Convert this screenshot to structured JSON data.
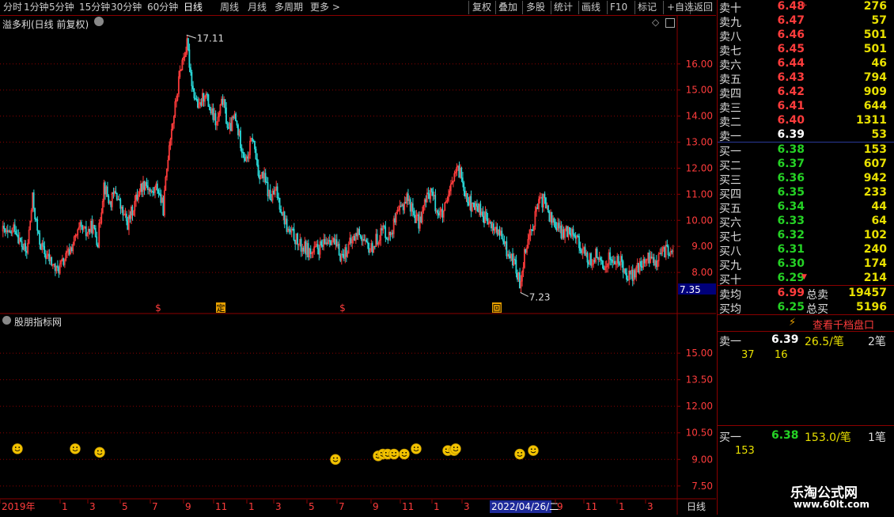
{
  "toolbar": {
    "periods": [
      "分时",
      "1分钟",
      "5分钟",
      "15分钟",
      "30分钟",
      "60分钟",
      "日线",
      "周线",
      "月线",
      "多周期",
      "更多 >"
    ],
    "active_period": "日线",
    "actions": [
      "复权",
      "叠加",
      "多股",
      "统计",
      "画线",
      "F10",
      "标记",
      "+自选",
      "返回"
    ]
  },
  "main_chart": {
    "title": "溢多利(日线 前复权)",
    "high_label": "17.11",
    "low_label": "7.23",
    "current_price": "7.35",
    "markers": [
      {
        "text": "$",
        "x": 200
      },
      {
        "text": "定",
        "x": 279
      },
      {
        "text": "$",
        "x": 433
      },
      {
        "text": "回",
        "x": 628
      }
    ]
  },
  "indicator": {
    "title": "股朋指标网"
  },
  "x_axis": {
    "date_cursor": "2022/04/26/二",
    "period_label": "日线"
  },
  "order_book": {
    "asks": [
      {
        "label": "卖十",
        "price": "6.48",
        "vol": "276",
        "mark": "+"
      },
      {
        "label": "卖九",
        "price": "6.47",
        "vol": "57"
      },
      {
        "label": "卖八",
        "price": "6.46",
        "vol": "501"
      },
      {
        "label": "卖七",
        "price": "6.45",
        "vol": "501"
      },
      {
        "label": "卖六",
        "price": "6.44",
        "vol": "46"
      },
      {
        "label": "卖五",
        "price": "6.43",
        "vol": "794"
      },
      {
        "label": "卖四",
        "price": "6.42",
        "vol": "909"
      },
      {
        "label": "卖三",
        "price": "6.41",
        "vol": "644"
      },
      {
        "label": "卖二",
        "price": "6.40",
        "vol": "1311"
      },
      {
        "label": "卖一",
        "price": "6.39",
        "vol": "53"
      }
    ],
    "bids": [
      {
        "label": "买一",
        "price": "6.38",
        "vol": "153"
      },
      {
        "label": "买二",
        "price": "6.37",
        "vol": "607"
      },
      {
        "label": "买三",
        "price": "6.36",
        "vol": "942"
      },
      {
        "label": "买四",
        "price": "6.35",
        "vol": "233"
      },
      {
        "label": "买五",
        "price": "6.34",
        "vol": "44"
      },
      {
        "label": "买六",
        "price": "6.33",
        "vol": "64"
      },
      {
        "label": "买七",
        "price": "6.32",
        "vol": "102"
      },
      {
        "label": "买八",
        "price": "6.31",
        "vol": "240"
      },
      {
        "label": "买九",
        "price": "6.30",
        "vol": "174"
      },
      {
        "label": "买十",
        "price": "6.29",
        "vol": "214",
        "mark": "▼"
      }
    ],
    "avg_sell_label": "卖均",
    "avg_sell": "6.99",
    "total_sell_label": "总卖",
    "total_sell": "19457",
    "avg_buy_label": "买均",
    "avg_buy": "6.25",
    "total_buy_label": "总买",
    "total_buy": "5196",
    "view_thousand": "查看千档盘口",
    "lightning": "⚡",
    "queue_sell": {
      "label": "卖一",
      "price": "6.39",
      "avg": "26.5/笔",
      "count": "2笔",
      "orders": [
        "37",
        "16"
      ]
    },
    "queue_buy": {
      "label": "买一",
      "price": "6.38",
      "avg": "153.0/笔",
      "count": "1笔",
      "orders": [
        "153"
      ]
    }
  },
  "watermark": {
    "name": "乐淘公式网",
    "url": "www.60lt.com"
  },
  "colors": {
    "up": "#ff3c3c",
    "down": "#2ad6d6",
    "grid": "#8b0000",
    "axis": "#ff3c3c"
  },
  "chart_data": [
    {
      "type": "candlestick",
      "title": "溢多利(日线 前复权)",
      "y_ticks": [
        8.0,
        9.0,
        10.0,
        11.0,
        12.0,
        13.0,
        14.0,
        15.0,
        16.0
      ],
      "ylim": [
        7.0,
        17.3
      ],
      "x_ticks": [
        "2019年",
        "1",
        "3",
        "5",
        "7",
        "9",
        "11",
        "1",
        "3",
        "5",
        "7",
        "9",
        "11",
        "1",
        "3",
        "2022/04/26/二",
        "9",
        "11",
        "1",
        "3"
      ],
      "close_series": [
        9.5,
        9.3,
        9.7,
        9.0,
        8.6,
        10.8,
        9.2,
        8.6,
        8.3,
        7.9,
        8.2,
        8.6,
        9.1,
        9.6,
        9.4,
        9.7,
        9.1,
        11.4,
        10.6,
        11.1,
        10.3,
        9.8,
        10.5,
        11.2,
        11.5,
        11.0,
        11.3,
        10.4,
        13.1,
        14.5,
        16.2,
        17.0,
        15.2,
        14.4,
        15.1,
        14.3,
        13.8,
        14.8,
        13.5,
        14.1,
        13.1,
        12.3,
        13.3,
        11.9,
        11.6,
        10.8,
        11.1,
        10.3,
        9.5,
        9.3,
        8.9,
        8.8,
        8.6,
        8.8,
        8.9,
        9.3,
        8.9,
        8.5,
        8.8,
        9.2,
        9.5,
        8.9,
        8.8,
        9.2,
        9.6,
        9.3,
        9.9,
        10.4,
        10.9,
        10.3,
        9.8,
        10.6,
        11.2,
        10.4,
        10.1,
        10.8,
        11.8,
        11.9,
        11.0,
        10.4,
        10.5,
        10.1,
        9.7,
        9.6,
        9.2,
        8.6,
        8.3,
        7.4,
        8.9,
        9.6,
        10.5,
        10.8,
        10.1,
        9.8,
        9.4,
        9.5,
        9.6,
        9.0,
        8.5,
        8.3,
        8.6,
        7.9,
        8.5,
        8.2,
        8.3,
        7.8,
        7.7,
        8.0,
        8.3,
        8.4,
        8.3,
        8.6,
        8.8,
        8.4
      ],
      "high": 17.11,
      "low": 7.23
    },
    {
      "type": "scatter",
      "title": "股朋指标网",
      "y_ticks": [
        7.5,
        9.0,
        10.5,
        12.0,
        13.5,
        15.0
      ],
      "ylim": [
        7.0,
        16.3
      ],
      "x": [
        22,
        95,
        126,
        424,
        478,
        484,
        490,
        498,
        511,
        526,
        566,
        574,
        576,
        657,
        674
      ],
      "values": [
        9.6,
        9.6,
        9.4,
        9.0,
        9.2,
        9.3,
        9.3,
        9.3,
        9.3,
        9.6,
        9.5,
        9.5,
        9.6,
        9.3,
        9.5
      ]
    }
  ]
}
